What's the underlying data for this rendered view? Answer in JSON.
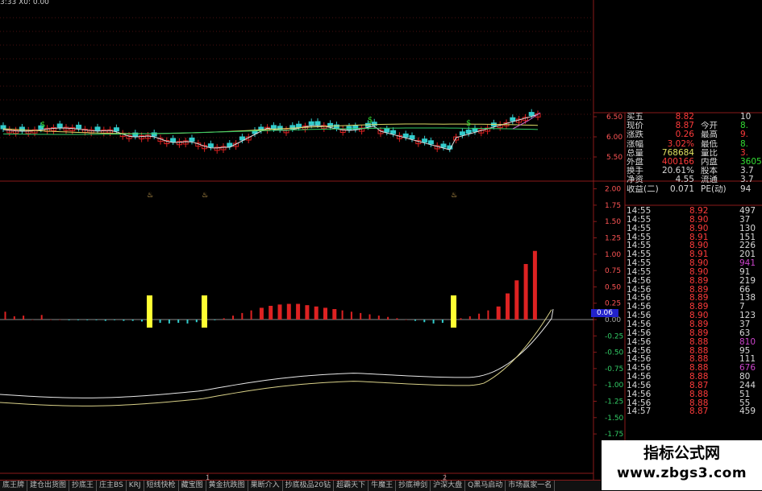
{
  "header": {
    "info": "3:33   X0: 0.00"
  },
  "main_chart": {
    "axis_labels": [
      "6.50",
      "6.00",
      "5.50"
    ],
    "signal_mark": "$"
  },
  "indicator": {
    "axis_labels": [
      "2.00",
      "1.75",
      "1.50",
      "1.25",
      "1.00",
      "0.75",
      "0.50",
      "0.25",
      "0.00",
      "-0.25",
      "-0.50",
      "-0.75",
      "-1.00",
      "-1.25",
      "-1.50",
      "-1.75"
    ],
    "current_value": "0.06",
    "bars": [
      0.12,
      0.05,
      0.06,
      0.0,
      0.07,
      0.0,
      0.0,
      -0.01,
      -0.01,
      -0.01,
      -0.01,
      -0.02,
      -0.01,
      -0.02,
      -0.02,
      -0.03,
      -0.04,
      -0.05,
      -0.06,
      -0.05,
      -0.06,
      -0.04,
      -0.03,
      -0.01,
      0.02,
      0.06,
      0.1,
      0.14,
      0.18,
      0.21,
      0.23,
      0.24,
      0.24,
      0.22,
      0.2,
      0.18,
      0.16,
      0.14,
      0.12,
      0.1,
      0.08,
      0.06,
      0.04,
      0.02,
      0.0,
      -0.02,
      -0.04,
      -0.06,
      -0.05,
      -0.03,
      0.02,
      0.05,
      0.09,
      0.14,
      0.2,
      0.4,
      0.6,
      0.85,
      1.05
    ],
    "signal_days": [
      27,
      37,
      82
    ]
  },
  "quote": [
    {
      "l": "买五",
      "v": "8.82",
      "vc": "#ff3b3b",
      "l2": "",
      "v2": "10",
      "v2c": "#d8d8d8"
    },
    {
      "l": "现价",
      "v": "8.87",
      "vc": "#ff3b3b",
      "l2": "今开",
      "v2": "8.",
      "v2c": "#33dd33"
    },
    {
      "l": "涨跌",
      "v": "0.26",
      "vc": "#ff3b3b",
      "l2": "最高",
      "v2": "9.",
      "v2c": "#ff3b3b"
    },
    {
      "l": "涨幅",
      "v": "3.02%",
      "vc": "#ff3b3b",
      "l2": "最低",
      "v2": "8.",
      "v2c": "#33dd33"
    },
    {
      "l": "总量",
      "v": "768684",
      "vc": "#e0e060",
      "l2": "量比",
      "v2": "3.",
      "v2c": "#ff3b3b"
    },
    {
      "l": "外盘",
      "v": "400166",
      "vc": "#ff3b3b",
      "l2": "内盘",
      "v2": "3605",
      "v2c": "#33dd33"
    },
    {
      "l": "换手",
      "v": "20.61%",
      "vc": "#d8d8d8",
      "l2": "股本",
      "v2": "3.7",
      "v2c": "#d8d8d8"
    },
    {
      "l": "净资",
      "v": "4.55",
      "vc": "#d8d8d8",
      "l2": "流通",
      "v2": "3.7",
      "v2c": "#d8d8d8"
    },
    {
      "l": "收益(二)",
      "v": "0.071",
      "vc": "#d8d8d8",
      "l2": "PE(动)",
      "v2": "94",
      "v2c": "#d8d8d8"
    }
  ],
  "ticks": [
    {
      "t": "14:55",
      "p": "8.92",
      "q": "497",
      "qc": "#d8d8d8"
    },
    {
      "t": "14:55",
      "p": "8.90",
      "q": "37",
      "qc": "#d8d8d8"
    },
    {
      "t": "14:55",
      "p": "8.90",
      "q": "130",
      "qc": "#d8d8d8"
    },
    {
      "t": "14:55",
      "p": "8.91",
      "q": "151",
      "qc": "#d8d8d8"
    },
    {
      "t": "14:55",
      "p": "8.90",
      "q": "226",
      "qc": "#d8d8d8"
    },
    {
      "t": "14:55",
      "p": "8.91",
      "q": "201",
      "qc": "#d8d8d8"
    },
    {
      "t": "14:55",
      "p": "8.90",
      "q": "941",
      "qc": "#cc44cc"
    },
    {
      "t": "14:55",
      "p": "8.90",
      "q": "91",
      "qc": "#d8d8d8"
    },
    {
      "t": "14:56",
      "p": "8.89",
      "q": "219",
      "qc": "#d8d8d8"
    },
    {
      "t": "14:56",
      "p": "8.89",
      "q": "66",
      "qc": "#d8d8d8"
    },
    {
      "t": "14:56",
      "p": "8.89",
      "q": "138",
      "qc": "#d8d8d8"
    },
    {
      "t": "14:56",
      "p": "8.89",
      "q": "7",
      "qc": "#d8d8d8"
    },
    {
      "t": "14:56",
      "p": "8.90",
      "q": "123",
      "qc": "#d8d8d8"
    },
    {
      "t": "14:56",
      "p": "8.89",
      "q": "37",
      "qc": "#d8d8d8"
    },
    {
      "t": "14:56",
      "p": "8.89",
      "q": "63",
      "qc": "#d8d8d8"
    },
    {
      "t": "14:56",
      "p": "8.88",
      "q": "810",
      "qc": "#cc44cc"
    },
    {
      "t": "14:56",
      "p": "8.88",
      "q": "95",
      "qc": "#d8d8d8"
    },
    {
      "t": "14:56",
      "p": "8.88",
      "q": "111",
      "qc": "#d8d8d8"
    },
    {
      "t": "14:56",
      "p": "8.88",
      "q": "676",
      "qc": "#cc44cc"
    },
    {
      "t": "14:56",
      "p": "8.88",
      "q": "80",
      "qc": "#d8d8d8"
    },
    {
      "t": "14:56",
      "p": "8.87",
      "q": "244",
      "qc": "#d8d8d8"
    },
    {
      "t": "14:56",
      "p": "8.88",
      "q": "51",
      "qc": "#d8d8d8"
    },
    {
      "t": "14:56",
      "p": "8.88",
      "q": "55",
      "qc": "#d8d8d8"
    },
    {
      "t": "14:57",
      "p": "8.87",
      "q": "459",
      "qc": "#d8d8d8"
    }
  ],
  "tabs": [
    "底王牌",
    "建仓出货图",
    "抄底王",
    "庄主BS",
    "KRJ",
    "短线快枪",
    "藏宝图",
    "黄金抗跌图",
    "果断介入",
    "抄底极品20钻",
    "超霸天下",
    "牛魔王",
    "抄底神剑",
    "沪深大盘",
    "Q黑马启动",
    "市场赢家一名"
  ],
  "watermark": {
    "line1": "指标公式网",
    "line2": "www.zbgs3.com"
  },
  "colors": {
    "up": "#dd2222",
    "down": "#33cccc",
    "grid": "#8a1a1a",
    "signal": "#ffff33",
    "ma_white": "#dddddd",
    "ma_yellow": "#dddd66",
    "ma_green": "#33cc66",
    "ma_pink": "#cc66cc"
  }
}
